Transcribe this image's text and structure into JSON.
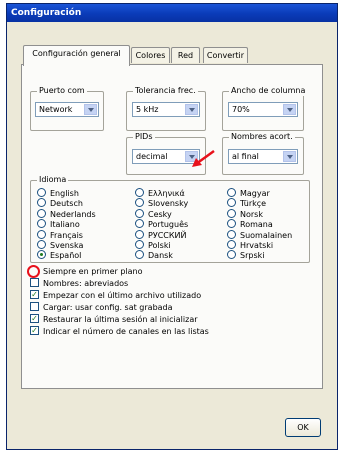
{
  "window": {
    "title": "Configuración"
  },
  "tabs": [
    {
      "label": "Configuración general",
      "active": true
    },
    {
      "label": "Colores",
      "active": false
    },
    {
      "label": "Red",
      "active": false
    },
    {
      "label": "Convertir",
      "active": false
    }
  ],
  "puerto": {
    "legend": "Puerto com",
    "value": "Network"
  },
  "tolerancia": {
    "legend": "Tolerancia frec.",
    "value": "5 kHz"
  },
  "ancho": {
    "legend": "Ancho de columna",
    "value": "70%"
  },
  "pids": {
    "legend": "PIDs",
    "value": "decimal"
  },
  "nombres": {
    "legend": "Nombres acort.",
    "value": "al final"
  },
  "idioma": {
    "legend": "Idioma",
    "languages": [
      "English",
      "Ελληνικά",
      "Magyar",
      "Deutsch",
      "Slovensky",
      "Türkçe",
      "Nederlands",
      "Cesky",
      "Norsk",
      "Italiano",
      "Português",
      "Romana",
      "Français",
      "РУССКИЙ",
      "Suomalainen",
      "Svenska",
      "Polski",
      "Hrvatski",
      "Español",
      "Dansk",
      "Srpski"
    ],
    "selected": "Español"
  },
  "checks": [
    {
      "label": "Siempre en primer plano",
      "checked": false,
      "highlight": true
    },
    {
      "label": "Nombres: abreviados",
      "checked": false
    },
    {
      "label": "Empezar con el último archivo utilizado",
      "checked": true
    },
    {
      "label": "Cargar: usar config. sat grabada",
      "checked": false
    },
    {
      "label": "Restaurar la última sesión al inicializar",
      "checked": true
    },
    {
      "label": "Indicar el número de canales en las listas",
      "checked": true
    }
  ],
  "ok_button": {
    "label": "OK"
  },
  "colors": {
    "title_bar": "#0a3bb8",
    "annotation": "#e8111b",
    "check": "#1f7a1f"
  }
}
